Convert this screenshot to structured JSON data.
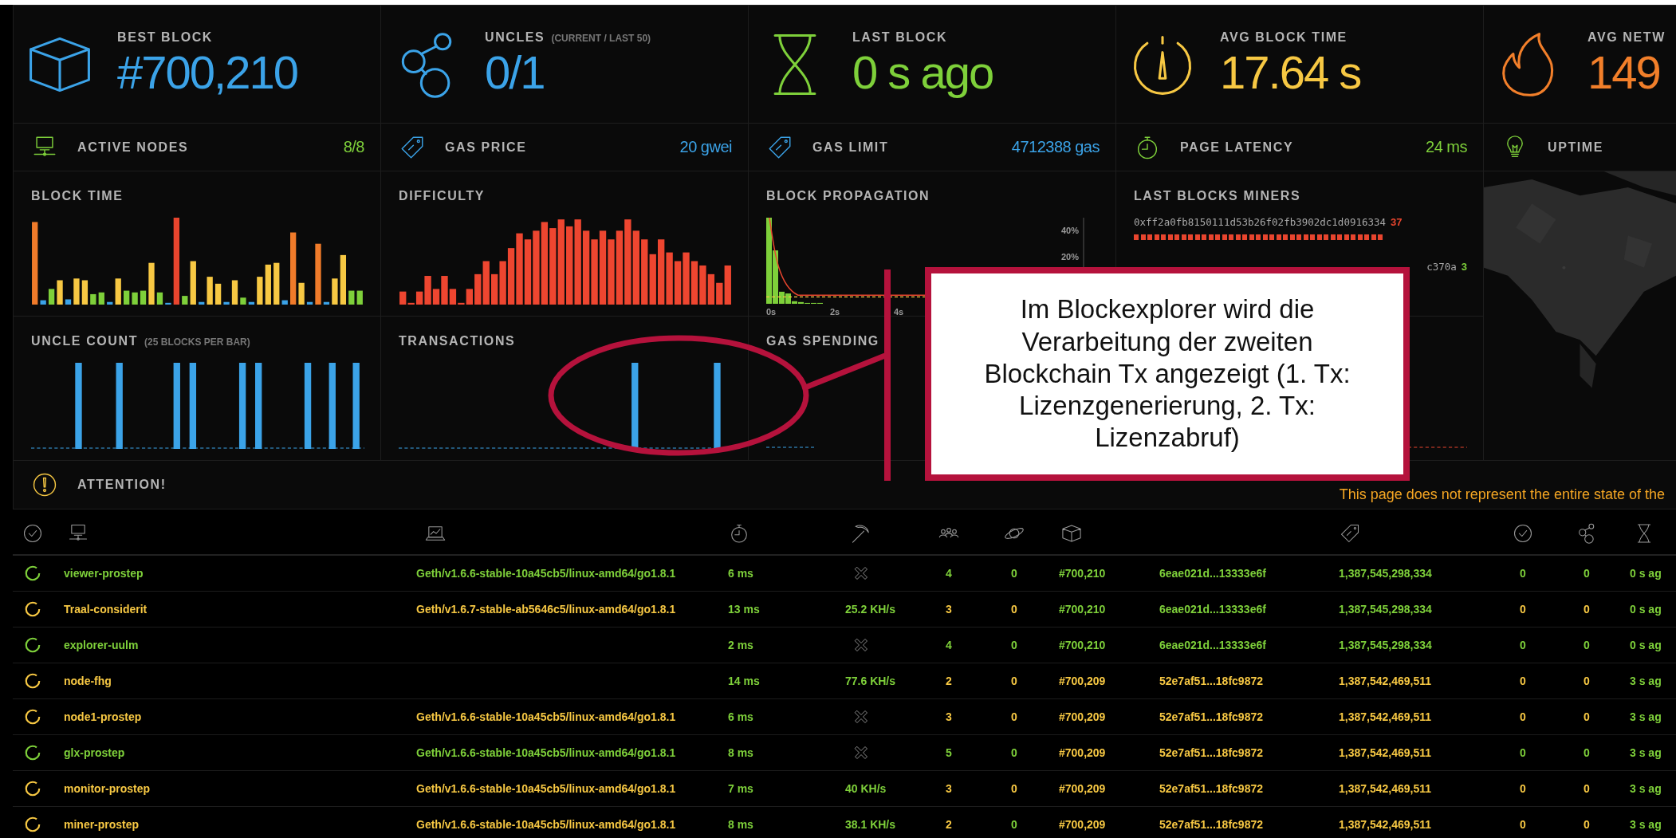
{
  "stats": [
    {
      "label": "BEST BLOCK",
      "value": "#700,210",
      "color": "#3ba3e8"
    },
    {
      "label": "UNCLES",
      "note": "(CURRENT / LAST 50)",
      "value": "0/1",
      "color": "#3ba3e8"
    },
    {
      "label": "LAST BLOCK",
      "value": "0 s ago",
      "color": "#7ed03a"
    },
    {
      "label": "AVG BLOCK TIME",
      "value": "17.64 s",
      "color": "#f7c843"
    },
    {
      "label": "AVG NETW",
      "value": "149",
      "color": "#f27f2a"
    }
  ],
  "metrics": [
    {
      "label": "ACTIVE NODES",
      "value": "8/8",
      "color": "#7ed03a"
    },
    {
      "label": "GAS PRICE",
      "value": "20 gwei",
      "color": "#3ba3e8"
    },
    {
      "label": "GAS LIMIT",
      "value": "4712388 gas",
      "color": "#3ba3e8"
    },
    {
      "label": "PAGE LATENCY",
      "value": "24 ms",
      "color": "#7ed03a"
    },
    {
      "label": "UPTIME",
      "color": "#7ed03a"
    }
  ],
  "charts": [
    {
      "kind": "block-time",
      "title": "BLOCK TIME"
    },
    {
      "kind": "difficulty",
      "title": "DIFFICULTY"
    },
    {
      "kind": "propagation",
      "title": "BLOCK PROPAGATION",
      "x_ticks": [
        "0s",
        "2s",
        "4s"
      ],
      "y_ticks": [
        "40%",
        "20%"
      ]
    },
    {
      "kind": "miners",
      "title": "LAST BLOCKS MINERS",
      "miners": [
        {
          "address": "0xff2a0fb8150111d53b26f02fb3902dc1d0916334",
          "count": "37",
          "color": "#e8452e"
        },
        {
          "address": "c370a",
          "count": "3",
          "color": "#7ed03a"
        }
      ]
    },
    {
      "kind": "uncles",
      "title": "UNCLE COUNT",
      "note": "(25 BLOCKS PER BAR)"
    },
    {
      "kind": "transactions",
      "title": "TRANSACTIONS"
    },
    {
      "kind": "gas",
      "title": "GAS SPENDING"
    },
    {
      "kind": "baseline"
    }
  ],
  "attention": {
    "title": "ATTENTION!",
    "message": "This page does not represent the entire state of the"
  },
  "annotation": {
    "text": "Im Blockexplorer wird die Verarbeitung der zweiten Blockchain Tx angezeigt (1. Tx: Lizenzgenerierung, 2. Tx: Lizenzabruf)"
  },
  "table": {
    "rows": [
      {
        "color": "#7ed03a",
        "cells": [
          {
            "text": "viewer-prostep",
            "color": "#7ed03a"
          },
          {
            "text": "Geth/v1.6.6-stable-10a45cb5/linux-amd64/go1.8.1",
            "color": "#7ed03a"
          },
          {
            "text": "6 ms",
            "color": "#7ed03a"
          },
          {
            "kind": "no-hashrate"
          },
          {
            "text": "4",
            "color": "#7ed03a"
          },
          {
            "text": "0",
            "color": "#7ed03a"
          },
          {
            "text": "#700,210",
            "color": "#7ed03a"
          },
          {
            "text": "6eae021d...13333e6f",
            "color": "#7ed03a"
          },
          {
            "text": "1,387,545,298,334",
            "color": "#7ed03a"
          },
          {
            "text": "0",
            "color": "#7ed03a"
          },
          {
            "text": "0",
            "color": "#7ed03a"
          },
          {
            "text": "0 s ag",
            "color": "#7ed03a"
          }
        ]
      },
      {
        "color": "#f7c843",
        "cells": [
          {
            "text": "Traal-considerit",
            "color": "#f7c843"
          },
          {
            "text": "Geth/v1.6.7-stable-ab5646c5/linux-amd64/go1.8.1",
            "color": "#f7c843"
          },
          {
            "text": "13 ms",
            "color": "#7ed03a"
          },
          {
            "text": "25.2 KH/s",
            "color": "#7ed03a"
          },
          {
            "text": "3",
            "color": "#f7c843"
          },
          {
            "text": "0",
            "color": "#f7c843"
          },
          {
            "text": "#700,210",
            "color": "#7ed03a"
          },
          {
            "text": "6eae021d...13333e6f",
            "color": "#7ed03a"
          },
          {
            "text": "1,387,545,298,334",
            "color": "#7ed03a"
          },
          {
            "text": "0",
            "color": "#f7c843"
          },
          {
            "text": "0",
            "color": "#f7c843"
          },
          {
            "text": "0 s ag",
            "color": "#7ed03a"
          }
        ]
      },
      {
        "color": "#7ed03a",
        "cells": [
          {
            "text": "explorer-uulm",
            "color": "#7ed03a"
          },
          {
            "kind": "blank"
          },
          {
            "text": "2 ms",
            "color": "#7ed03a"
          },
          {
            "kind": "no-hashrate"
          },
          {
            "text": "4",
            "color": "#7ed03a"
          },
          {
            "text": "0",
            "color": "#7ed03a"
          },
          {
            "text": "#700,210",
            "color": "#7ed03a"
          },
          {
            "text": "6eae021d...13333e6f",
            "color": "#7ed03a"
          },
          {
            "text": "1,387,545,298,334",
            "color": "#7ed03a"
          },
          {
            "text": "0",
            "color": "#7ed03a"
          },
          {
            "text": "0",
            "color": "#7ed03a"
          },
          {
            "text": "0 s ag",
            "color": "#7ed03a"
          }
        ]
      },
      {
        "color": "#f7c843",
        "cells": [
          {
            "text": "node-fhg",
            "color": "#f7c843"
          },
          {
            "kind": "blank"
          },
          {
            "text": "14 ms",
            "color": "#7ed03a"
          },
          {
            "text": "77.6 KH/s",
            "color": "#7ed03a"
          },
          {
            "text": "2",
            "color": "#f7c843"
          },
          {
            "text": "0",
            "color": "#f7c843"
          },
          {
            "text": "#700,209",
            "color": "#f7c843"
          },
          {
            "text": "52e7af51...18fc9872",
            "color": "#f7c843"
          },
          {
            "text": "1,387,542,469,511",
            "color": "#f7c843"
          },
          {
            "text": "0",
            "color": "#f7c843"
          },
          {
            "text": "0",
            "color": "#f7c843"
          },
          {
            "text": "3 s ag",
            "color": "#7ed03a"
          }
        ]
      },
      {
        "color": "#f7c843",
        "cells": [
          {
            "text": "node1-prostep",
            "color": "#f7c843"
          },
          {
            "text": "Geth/v1.6.6-stable-10a45cb5/linux-amd64/go1.8.1",
            "color": "#f7c843"
          },
          {
            "text": "6 ms",
            "color": "#7ed03a"
          },
          {
            "kind": "no-hashrate"
          },
          {
            "text": "3",
            "color": "#f7c843"
          },
          {
            "text": "0",
            "color": "#f7c843"
          },
          {
            "text": "#700,209",
            "color": "#f7c843"
          },
          {
            "text": "52e7af51...18fc9872",
            "color": "#f7c843"
          },
          {
            "text": "1,387,542,469,511",
            "color": "#f7c843"
          },
          {
            "text": "0",
            "color": "#f7c843"
          },
          {
            "text": "0",
            "color": "#f7c843"
          },
          {
            "text": "3 s ag",
            "color": "#7ed03a"
          }
        ]
      },
      {
        "color": "#7ed03a",
        "cells": [
          {
            "text": "glx-prostep",
            "color": "#7ed03a"
          },
          {
            "text": "Geth/v1.6.6-stable-10a45cb5/linux-amd64/go1.8.1",
            "color": "#7ed03a"
          },
          {
            "text": "8 ms",
            "color": "#7ed03a"
          },
          {
            "kind": "no-hashrate"
          },
          {
            "text": "5",
            "color": "#7ed03a"
          },
          {
            "text": "0",
            "color": "#7ed03a"
          },
          {
            "text": "#700,209",
            "color": "#f7c843"
          },
          {
            "text": "52e7af51...18fc9872",
            "color": "#f7c843"
          },
          {
            "text": "1,387,542,469,511",
            "color": "#f7c843"
          },
          {
            "text": "0",
            "color": "#7ed03a"
          },
          {
            "text": "0",
            "color": "#7ed03a"
          },
          {
            "text": "3 s ag",
            "color": "#7ed03a"
          }
        ]
      },
      {
        "color": "#f7c843",
        "cells": [
          {
            "text": "monitor-prostep",
            "color": "#f7c843"
          },
          {
            "text": "Geth/v1.6.6-stable-10a45cb5/linux-amd64/go1.8.1",
            "color": "#f7c843"
          },
          {
            "text": "7 ms",
            "color": "#7ed03a"
          },
          {
            "text": "40 KH/s",
            "color": "#7ed03a"
          },
          {
            "text": "3",
            "color": "#f7c843"
          },
          {
            "text": "0",
            "color": "#f7c843"
          },
          {
            "text": "#700,209",
            "color": "#f7c843"
          },
          {
            "text": "52e7af51...18fc9872",
            "color": "#f7c843"
          },
          {
            "text": "1,387,542,469,511",
            "color": "#f7c843"
          },
          {
            "text": "0",
            "color": "#f7c843"
          },
          {
            "text": "0",
            "color": "#f7c843"
          },
          {
            "text": "3 s ag",
            "color": "#7ed03a"
          }
        ]
      },
      {
        "color": "#f7c843",
        "cells": [
          {
            "text": "miner-prostep",
            "color": "#f7c843"
          },
          {
            "text": "Geth/v1.6.6-stable-10a45cb5/linux-amd64/go1.8.1",
            "color": "#f7c843"
          },
          {
            "text": "8 ms",
            "color": "#7ed03a"
          },
          {
            "text": "38.1 KH/s",
            "color": "#7ed03a"
          },
          {
            "text": "2",
            "color": "#f7c843"
          },
          {
            "text": "0",
            "color": "#7ed03a"
          },
          {
            "text": "#700,209",
            "color": "#f7c843"
          },
          {
            "text": "52e7af51...18fc9872",
            "color": "#f7c843"
          },
          {
            "text": "1,387,542,469,511",
            "color": "#f7c843"
          },
          {
            "text": "0",
            "color": "#f7c843"
          },
          {
            "text": "0",
            "color": "#f7c843"
          },
          {
            "text": "3 s ag",
            "color": "#7ed03a"
          }
        ]
      }
    ]
  }
}
